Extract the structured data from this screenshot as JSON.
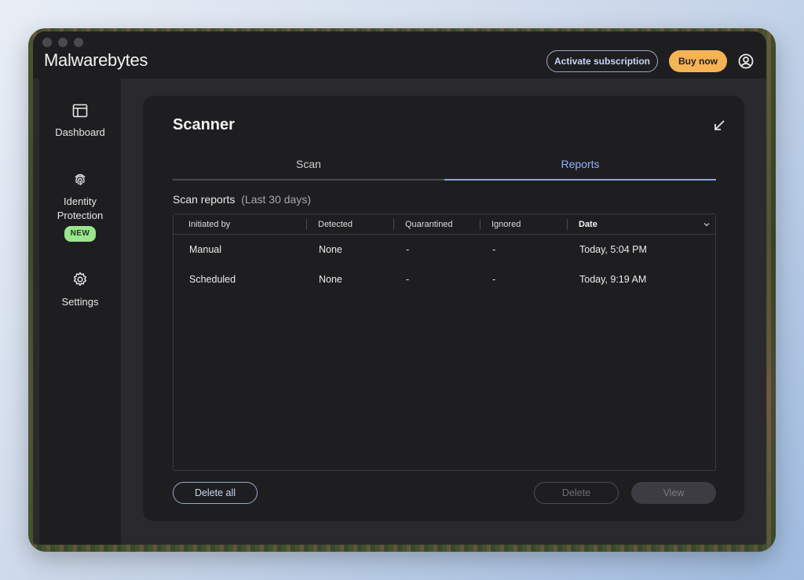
{
  "app": {
    "logo_text": "Malwarebytes"
  },
  "header": {
    "activate_label": "Activate subscription",
    "buy_label": "Buy now"
  },
  "sidebar": {
    "items": [
      {
        "label": "Dashboard",
        "icon": "dashboard-icon"
      },
      {
        "label": "Identity Protection",
        "icon": "fingerprint-icon",
        "badge": "NEW"
      },
      {
        "label": "Settings",
        "icon": "gear-icon"
      }
    ]
  },
  "scanner": {
    "title": "Scanner",
    "tabs": [
      {
        "label": "Scan",
        "active": false
      },
      {
        "label": "Reports",
        "active": true
      }
    ],
    "section_title": "Scan reports",
    "section_subtitle": "(Last 30 days)",
    "columns": [
      "Initiated by",
      "Detected",
      "Quarantined",
      "Ignored",
      "Date"
    ],
    "rows": [
      {
        "initiated_by": "Manual",
        "detected": "None",
        "quarantined": "-",
        "ignored": "-",
        "date": "Today, 5:04 PM"
      },
      {
        "initiated_by": "Scheduled",
        "detected": "None",
        "quarantined": "-",
        "ignored": "-",
        "date": "Today, 9:19 AM"
      }
    ],
    "buttons": {
      "delete_all": "Delete all",
      "delete": "Delete",
      "view": "View"
    }
  },
  "colors": {
    "accent": "#8fb0ff",
    "buy_button": "#f6b355",
    "badge_new": "#9be58f"
  }
}
